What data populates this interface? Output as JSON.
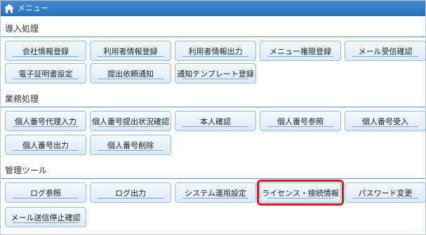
{
  "header": {
    "title": "メニュー",
    "icon": "home-icon"
  },
  "sections": [
    {
      "title": "導入処理",
      "buttons": [
        "会社情報登録",
        "利用者情報登録",
        "利用者情報出力",
        "メニュー権限登録",
        "メール受信確認",
        "電子証明書設定",
        "提出依頼通知",
        "通知テンプレート登録"
      ]
    },
    {
      "title": "業務処理",
      "buttons": [
        "個人番号代理入力",
        "個人番号提出状況確認",
        "本人確認",
        "個人番号参照",
        "個人番号受入",
        "個人番号出力",
        "個人番号削除"
      ]
    },
    {
      "title": "管理ツール",
      "buttons": [
        "ログ参照",
        "ログ出力",
        "システム運用設定",
        "ライセンス・接続情報",
        "パスワード変更",
        "メール送信停止確認"
      ]
    }
  ],
  "highlight": {
    "section": 2,
    "button": 3,
    "color": "#d9141e"
  }
}
